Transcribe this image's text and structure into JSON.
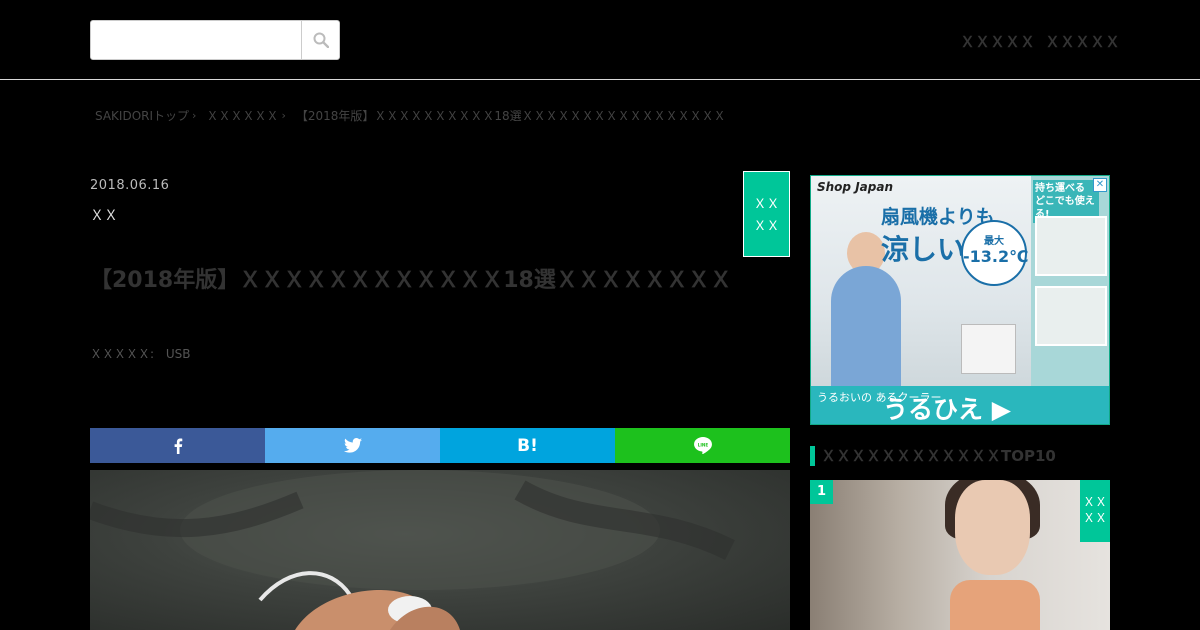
{
  "header": {
    "search": {
      "value": "",
      "placeholder": ""
    },
    "nav": [
      "ＸＸＸＸＸ",
      "ＸＸＸＸＸ"
    ]
  },
  "breadcrumb": {
    "items": [
      "SAKIDORIトップ",
      "ＸＸＸＸＸＸ",
      "【2018年版】ＸＸＸＸＸＸＸＸＸＸ18選ＸＸＸＸＸＸＸＸＸＸＸＸＸＸＸＸＸ"
    ]
  },
  "article": {
    "date": "2018.06.16",
    "category": "ＸＸ",
    "ribbon": [
      "ＸＸ",
      "ＸＸ"
    ],
    "title": "【2018年版】ＸＸＸＸＸＸＸＸＸＸＸＸ18選ＸＸＸＸＸＸＸＸＸＸＸＸＸＸＸＸＸ",
    "tags_label": "ＸＸＸＸＸ:",
    "tags": [
      "USB"
    ]
  },
  "share": {
    "facebook": "f",
    "twitter": "twitter",
    "hatena": "B!",
    "line": "LINE"
  },
  "ad": {
    "brand": "Shop Japan",
    "headline_1": "扇風機よりも",
    "headline_2": "涼しい!",
    "bubble_label": "最大",
    "bubble_value": "-13.2℃",
    "side_text": "持ち運べる どこでも使える!",
    "bottom_small": "うるおいの あるクーラー",
    "bottom_big": "うるひえ ▶"
  },
  "sidebar": {
    "ranking_title": "ＸＸＸＸＸＸＸＸＸＸＸＸTOP10",
    "rank_number": "1",
    "rank_ribbon": [
      "ＸＸ",
      "ＸＸ"
    ]
  },
  "colors": {
    "accent": "#00c699",
    "facebook": "#3b5998",
    "twitter": "#55acee",
    "hatena": "#00a4de",
    "line": "#1dc11d"
  }
}
